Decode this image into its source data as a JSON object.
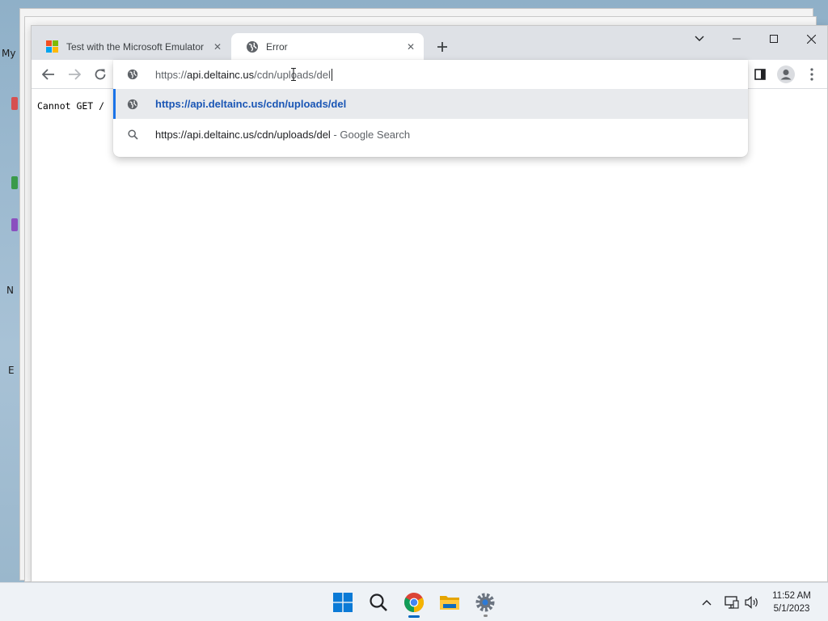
{
  "desktop": {
    "labels": [
      "My",
      "N",
      "E"
    ]
  },
  "browser": {
    "tabs": [
      {
        "title": "Test with the Microsoft Emulator",
        "favicon": "microsoft-logo-icon",
        "active": false
      },
      {
        "title": "Error",
        "favicon": "globe-icon",
        "active": true
      }
    ],
    "new_tab_icon": "plus-icon",
    "window_controls": [
      "chevron-down-icon",
      "minimize-icon",
      "maximize-icon",
      "close-icon"
    ],
    "toolbar": {
      "back_icon": "arrow-left-icon",
      "forward_icon": "arrow-right-icon",
      "reload_icon": "reload-icon",
      "side_panel_icon": "side-panel-icon",
      "profile_icon": "profile-icon",
      "menu_icon": "three-dots-icon"
    },
    "omnibox": {
      "value": "https://api.deltainc.us/cdn/uploads/del",
      "value_scheme": "https://",
      "value_host": "api.deltainc.us",
      "value_path": "/cdn/uploads/del",
      "suggestions": [
        {
          "icon": "globe-icon",
          "text": "https://api.deltainc.us/cdn/uploads/del",
          "description": ""
        },
        {
          "icon": "search-icon",
          "text": "https://api.deltainc.us/cdn/uploads/del",
          "description": " - Google Search"
        }
      ]
    },
    "page": {
      "text": "Cannot GET /"
    }
  },
  "taskbar": {
    "apps": [
      {
        "name": "start-button",
        "icon": "windows-logo-icon"
      },
      {
        "name": "search-button",
        "icon": "search-icon"
      },
      {
        "name": "chrome-app",
        "icon": "chrome-icon"
      },
      {
        "name": "file-explorer-app",
        "icon": "folder-icon"
      },
      {
        "name": "settings-app",
        "icon": "gear-icon"
      }
    ],
    "tray": {
      "icons": [
        "chevron-up-icon",
        "network-icon",
        "volume-icon"
      ],
      "time": "11:52 AM",
      "date": "5/1/2023"
    }
  },
  "colors": {
    "accent": "#1a73e8",
    "suggestion_link": "#1a56b5",
    "tab_strip": "#dee1e6",
    "selected_row": "#e8eaed"
  }
}
